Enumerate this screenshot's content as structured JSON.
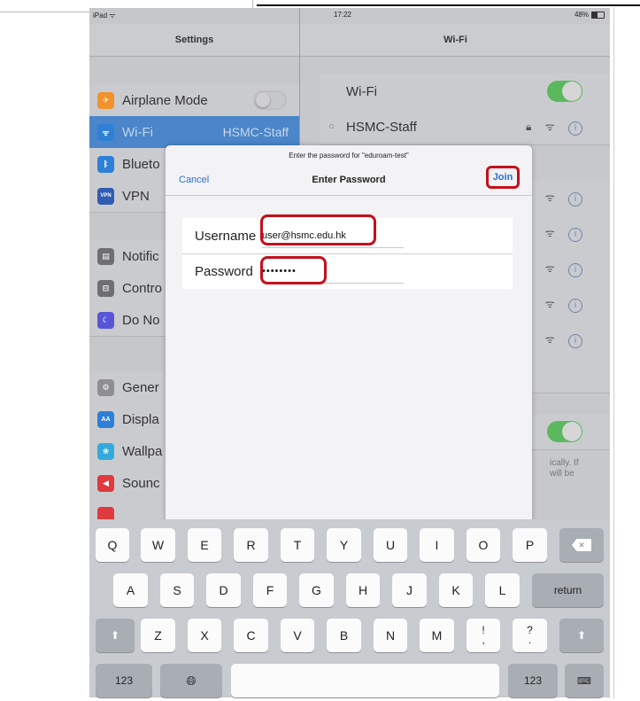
{
  "statusbar": {
    "carrier": "iPad ᯤ",
    "time": "17:22",
    "battery": "48%"
  },
  "left_pane": {
    "title": "Settings",
    "items": [
      {
        "label": "Airplane Mode",
        "icon": "airplane-icon",
        "color": "#f0932b"
      },
      {
        "label": "Wi-Fi",
        "value": "HSMC-Staff",
        "icon": "wifi-icon",
        "color": "#2e7fd6"
      },
      {
        "label": "Blueto",
        "icon": "bluetooth-icon",
        "color": "#2e7fd6"
      },
      {
        "label": "VPN",
        "icon": "vpn-icon",
        "color": "#2e5db3"
      },
      {
        "label": "Notific",
        "icon": "notifications-icon",
        "color": "#6f6f73"
      },
      {
        "label": "Contro",
        "icon": "control-center-icon",
        "color": "#6f6f73"
      },
      {
        "label": "Do No",
        "icon": "moon-icon",
        "color": "#5856d6"
      },
      {
        "label": "Gener",
        "icon": "gear-icon",
        "color": "#8e8e93"
      },
      {
        "label": "Displa",
        "icon": "display-icon",
        "color": "#2e7fd6"
      },
      {
        "label": "Wallpa",
        "icon": "wallpaper-icon",
        "color": "#34aadc"
      },
      {
        "label": "Sounc",
        "icon": "sound-icon",
        "color": "#e0393e"
      }
    ]
  },
  "right_pane": {
    "title": "Wi-Fi",
    "wifi_label": "Wi-Fi",
    "connected_network": "HSMC-Staff",
    "note": "ically. If\nwill be"
  },
  "modal": {
    "prompt": "Enter the password for \"eduroam-test\"",
    "cancel_label": "Cancel",
    "title": "Enter Password",
    "join_label": "Join",
    "username_label": "Username",
    "username_value": "user@hsmc.edu.hk",
    "password_label": "Password",
    "password_value": "••••••••"
  },
  "keyboard": {
    "row1": [
      "Q",
      "W",
      "E",
      "R",
      "T",
      "Y",
      "U",
      "I",
      "O",
      "P"
    ],
    "row2": [
      "A",
      "S",
      "D",
      "F",
      "G",
      "H",
      "J",
      "K",
      "L"
    ],
    "row3": [
      "Z",
      "X",
      "C",
      "V",
      "B",
      "N",
      "M",
      "!\n,",
      "?\n."
    ],
    "return_label": "return",
    "numbers_label": "123"
  },
  "colors": {
    "accent": "#2a6fd1",
    "highlight": "#c40f1c",
    "toggle_on": "#5cb85c"
  }
}
